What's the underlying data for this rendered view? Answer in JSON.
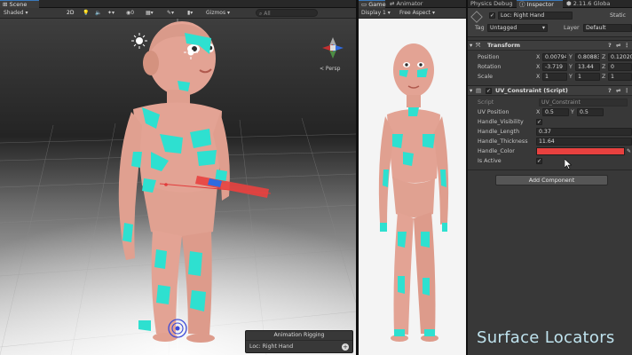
{
  "scene_panel": {
    "tab_label": "Scene",
    "toolbar": {
      "shading_mode": "Shaded",
      "mode_2d": "2D",
      "fx_count": "0",
      "gizmos_label": "Gizmos",
      "search_placeholder": "All"
    },
    "view_gizmo_label": "< Persp"
  },
  "game_panel": {
    "tabs": [
      {
        "label": "Game"
      },
      {
        "label": "Animator"
      }
    ],
    "display_label": "Display 1",
    "aspect_label": "Free Aspect"
  },
  "inspector_panel": {
    "tabs": [
      {
        "label": "Physics Debug"
      },
      {
        "label": "Inspector"
      },
      {
        "label": "2.11.6 Globa"
      }
    ],
    "object_name": "Loc: Right Hand",
    "static_label": "Static",
    "tag_label": "Tag",
    "tag_value": "Untagged",
    "layer_label": "Layer",
    "layer_value": "Default",
    "transform": {
      "title": "Transform",
      "position_label": "Position",
      "position": {
        "x": "0.00794",
        "y": "0.80883",
        "z": "0.12020"
      },
      "rotation_label": "Rotation",
      "rotation": {
        "x": "-3.719",
        "y": "13.44",
        "z": "0"
      },
      "scale_label": "Scale",
      "scale": {
        "x": "1",
        "y": "1",
        "z": "1"
      }
    },
    "uv_constraint": {
      "title": "UV_Constraint (Script)",
      "script_label": "Script",
      "script_value": "UV_Constraint",
      "uv_position_label": "UV Position",
      "uv_x": "0.5",
      "uv_y": "0.5",
      "handle_visibility_label": "Handle_Visibility",
      "handle_length_label": "Handle_Length",
      "handle_length": "0.37",
      "handle_thickness_label": "Handle_Thickness",
      "handle_thickness": "11.64",
      "handle_color_label": "Handle_Color",
      "handle_color": "#e8413f",
      "is_active_label": "Is Active"
    },
    "add_component_label": "Add Component"
  },
  "overlay_panel": {
    "title": "Animation Rigging",
    "item": "Loc: Right Hand"
  },
  "watermark": "Surface Locators",
  "colors": {
    "accent_blue": "#3a79bb",
    "cyan_locator": "#2ee0d0",
    "skin": "#e3a394",
    "gizmo_red": "#e23b3b",
    "gizmo_blue": "#2e6be0"
  }
}
